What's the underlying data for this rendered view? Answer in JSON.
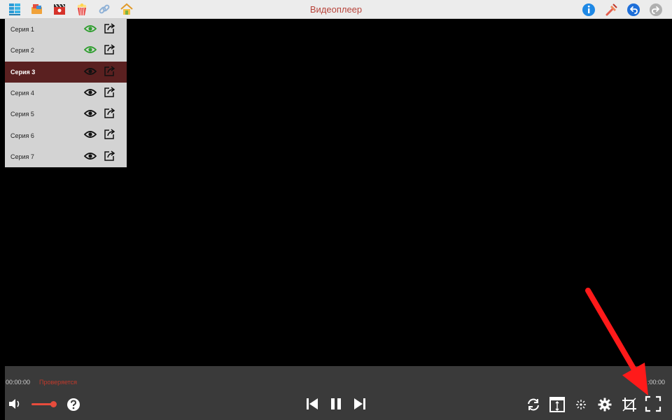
{
  "app": {
    "title": "Видеоплеер"
  },
  "toolbar_left": [
    "grid-menu-icon",
    "folder-video-icon",
    "clapperboard-icon",
    "popcorn-icon",
    "link-icon",
    "home-icon"
  ],
  "toolbar_right": [
    "info-icon",
    "tools-icon",
    "undo-icon",
    "redo-icon"
  ],
  "playlist": {
    "items": [
      {
        "label": "Серия 1",
        "watched": true,
        "active": false
      },
      {
        "label": "Серия 2",
        "watched": true,
        "active": false
      },
      {
        "label": "Серия 3",
        "watched": false,
        "active": true
      },
      {
        "label": "Серия 4",
        "watched": false,
        "active": false
      },
      {
        "label": "Серия 5",
        "watched": false,
        "active": false
      },
      {
        "label": "Серия 6",
        "watched": false,
        "active": false
      },
      {
        "label": "Серия 7",
        "watched": false,
        "active": false
      }
    ]
  },
  "player": {
    "time_current": "00:00:00",
    "status": "Проверяется",
    "time_total": ":00:00",
    "volume_level": 0.85
  },
  "colors": {
    "accent": "#e74c3c",
    "title": "#b8453c",
    "active_row": "#5a2020",
    "watched_eye": "#2e9e2e",
    "annotation": "#ff1a1a"
  }
}
